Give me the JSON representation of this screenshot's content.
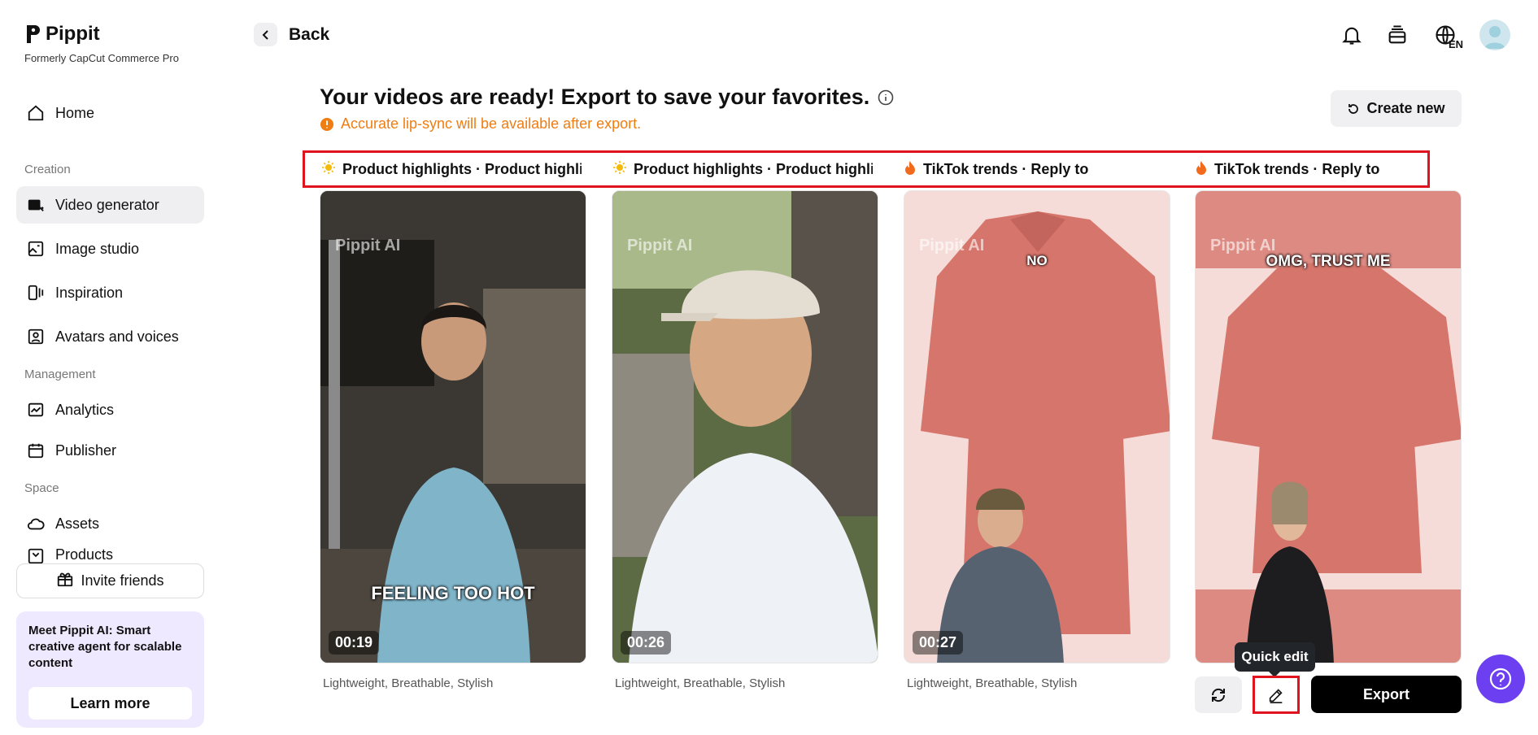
{
  "brand": {
    "name": "Pippit",
    "subtitle": "Formerly CapCut Commerce Pro"
  },
  "nav": {
    "home": "Home",
    "creation_label": "Creation",
    "video_generator": "Video generator",
    "image_studio": "Image studio",
    "inspiration": "Inspiration",
    "avatars": "Avatars and voices",
    "management_label": "Management",
    "analytics": "Analytics",
    "publisher": "Publisher",
    "space_label": "Space",
    "assets": "Assets",
    "products": "Products"
  },
  "invite": "Invite friends",
  "promo": {
    "text": "Meet Pippit AI: Smart creative agent for scalable content",
    "button": "Learn more"
  },
  "header": {
    "back": "Back",
    "lang": "EN"
  },
  "main": {
    "title": "Your videos are ready! Export to save your favorites.",
    "notice": "Accurate lip-sync will be available after export.",
    "create_new": "Create new"
  },
  "tags": [
    {
      "icon": "sun-icon",
      "text": "Product highlights · Product highli..."
    },
    {
      "icon": "sun-icon",
      "text": "Product highlights · Product highli..."
    },
    {
      "icon": "fire-icon",
      "text": "TikTok trends · Reply to"
    },
    {
      "icon": "fire-icon",
      "text": "TikTok trends · Reply to"
    }
  ],
  "videos": [
    {
      "duration": "00:19",
      "caption": "FEELING TOO HOT",
      "desc": "Lightweight, Breathable, Stylish",
      "watermark": "Pippit AI"
    },
    {
      "duration": "00:26",
      "caption": "",
      "desc": "Lightweight, Breathable, Stylish",
      "watermark": "Pippit AI"
    },
    {
      "duration": "00:27",
      "caption": "NO",
      "desc": "Lightweight, Breathable, Stylish",
      "watermark": "Pippit AI"
    },
    {
      "duration": "",
      "caption": "OMG, TRUST ME",
      "desc": "",
      "watermark": "Pippit AI"
    }
  ],
  "actions": {
    "tooltip": "Quick edit",
    "export": "Export"
  },
  "colors": {
    "accent": "#6c3ff0",
    "warning": "#ef7d12",
    "highlight": "#e0141f",
    "shirt": "#d6756c"
  }
}
